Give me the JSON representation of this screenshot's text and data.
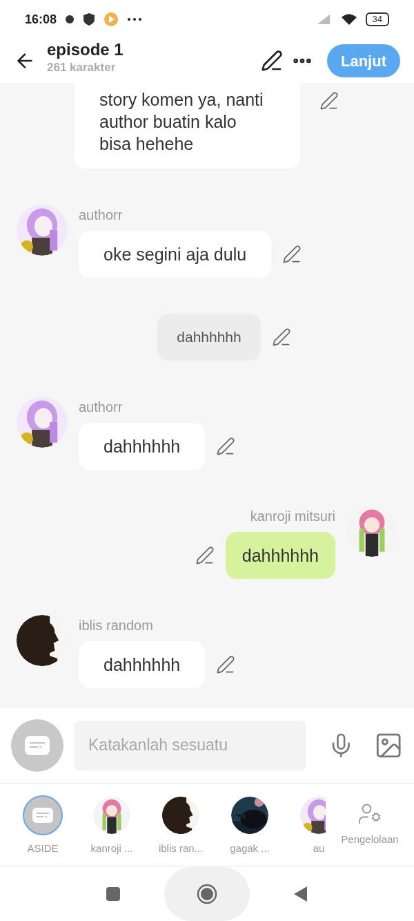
{
  "status_bar": {
    "time": "16:08",
    "battery": "34"
  },
  "header": {
    "title": "episode 1",
    "subtitle": "261 karakter",
    "next_button": "Lanjut"
  },
  "messages": [
    {
      "kind": "left_cut",
      "lines": [
        "story komen ya, nanti",
        "author buatin kalo",
        "bisa hehehe"
      ]
    },
    {
      "kind": "left",
      "name": "authorr",
      "lines": [
        "oke segini aja dulu"
      ]
    },
    {
      "kind": "aside",
      "lines": [
        "dahhhhhh"
      ]
    },
    {
      "kind": "left",
      "name": "authorr",
      "lines": [
        "dahhhhhh"
      ]
    },
    {
      "kind": "right",
      "name": "kanroji mitsuri",
      "lines": [
        "dahhhhhh"
      ]
    },
    {
      "kind": "left",
      "name": "iblis random",
      "lines": [
        "dahhhhhh"
      ]
    }
  ],
  "composer": {
    "placeholder": "Katakanlah sesuatu"
  },
  "characters": [
    {
      "kind": "aside",
      "label": "ASIDE",
      "selected": true
    },
    {
      "kind": "avatar",
      "label": "kanroji ...",
      "selected": false
    },
    {
      "kind": "avatar",
      "label": "iblis ran...",
      "selected": false
    },
    {
      "kind": "avatar",
      "label": "gagak ...",
      "selected": false
    },
    {
      "kind": "avatar",
      "label": "au",
      "selected": false
    }
  ],
  "manage_button": "Pengelolaan"
}
